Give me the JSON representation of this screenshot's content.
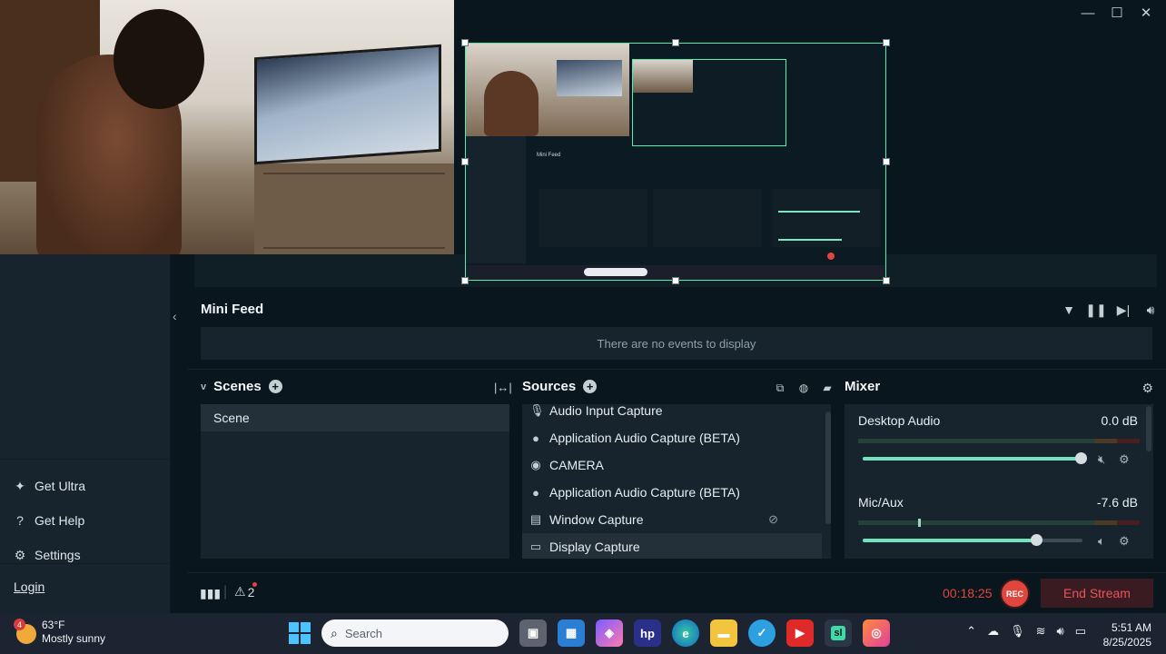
{
  "window": {
    "minimize_icon": "—",
    "maximize_icon": "☐",
    "close_icon": "✕"
  },
  "sidebar": {
    "items": [
      {
        "label": "Get Ultra",
        "icon": "ultra-icon"
      },
      {
        "label": "Get Help",
        "icon": "help-icon"
      },
      {
        "label": "Settings",
        "icon": "gear-icon"
      }
    ],
    "login": "Login"
  },
  "mini_feed": {
    "title": "Mini Feed",
    "empty_text": "There are no events to display"
  },
  "scenes": {
    "title": "Scenes",
    "items": [
      "Scene"
    ]
  },
  "sources": {
    "title": "Sources",
    "items": [
      {
        "label": "Audio Input Capture",
        "icon": "mic-icon"
      },
      {
        "label": "Application Audio Capture (BETA)",
        "icon": "person-icon"
      },
      {
        "label": "CAMERA",
        "icon": "camera-icon"
      },
      {
        "label": "Application Audio Capture (BETA)",
        "icon": "person-icon"
      },
      {
        "label": "Window Capture",
        "icon": "window-icon"
      },
      {
        "label": "Display Capture",
        "icon": "monitor-icon"
      }
    ]
  },
  "mixer": {
    "title": "Mixer",
    "channels": [
      {
        "name": "Desktop Audio",
        "db": "0.0 dB",
        "level": 0.99
      },
      {
        "name": "Mic/Aux",
        "db": "-7.6 dB",
        "level": 0.79
      }
    ]
  },
  "status": {
    "alerts": "2",
    "timer": "00:18:25",
    "rec_label": "REC",
    "end_stream": "End Stream"
  },
  "colors": {
    "accent": "#72e3bc",
    "live": "#e0463e",
    "bg": "#09161d",
    "panel": "#17242d"
  },
  "taskbar": {
    "weather_badge": "4",
    "temperature": "63°F",
    "condition": "Mostly sunny",
    "search_placeholder": "Search",
    "time": "5:51 AM",
    "date": "8/25/2025"
  }
}
